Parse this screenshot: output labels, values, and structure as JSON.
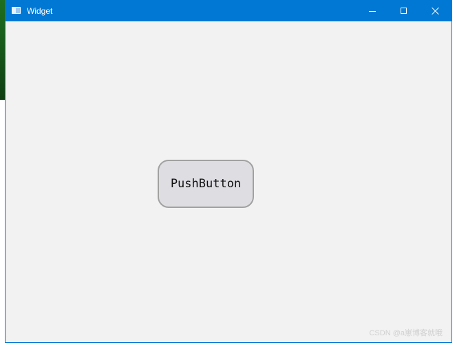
{
  "window": {
    "title": "Widget",
    "accent_color": "#0078d4",
    "background_color": "#f2f2f2"
  },
  "titlebar": {
    "app_icon": "window-app-icon",
    "controls": {
      "minimize_icon": "minimize-icon",
      "maximize_icon": "maximize-icon",
      "close_icon": "close-icon"
    }
  },
  "content": {
    "push_button_label": "PushButton"
  },
  "watermark": "CSDN @a崽博客就哦"
}
